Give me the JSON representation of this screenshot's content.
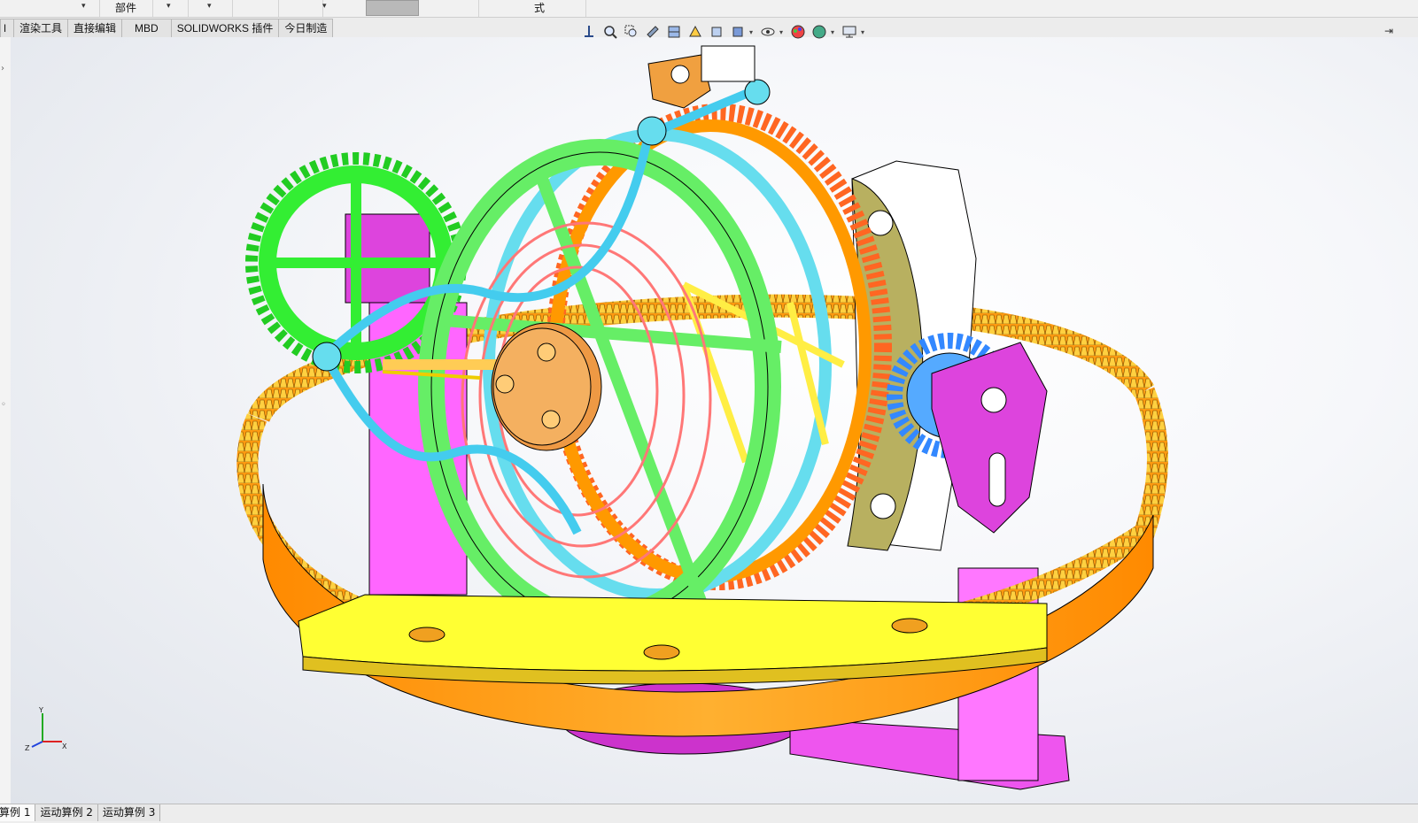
{
  "toolbar_top": {
    "assembly_label": "部件",
    "style_label": "式"
  },
  "tabs": [
    {
      "label": "渲染工具"
    },
    {
      "label": "直接编辑"
    },
    {
      "label": "MBD"
    },
    {
      "label": "SOLIDWORKS 插件"
    },
    {
      "label": "今日制造"
    }
  ],
  "heads_up_toolbar": [
    "view-orientation-icon",
    "zoom-to-fit-icon",
    "zoom-to-area-icon",
    "previous-view-icon",
    "section-view-icon",
    "dynamic-annotation-icon",
    "view-orientation-cube-icon",
    "display-style-icon",
    "hide-show-items-icon",
    "edit-appearance-icon",
    "apply-scene-icon",
    "view-settings-icon"
  ],
  "bottom_tabs": [
    {
      "label": "算例 1"
    },
    {
      "label": "运动算例 2"
    },
    {
      "label": "运动算例 3"
    }
  ],
  "triad": {
    "x": "X",
    "y": "Y",
    "z": "Z"
  },
  "colors": {
    "ring_gear": "#ff8c00",
    "frame_green": "#66ee66",
    "cage_cyan": "#66ddee",
    "support_magenta": "#ee44ee",
    "bridge_yellow": "#ffff33",
    "plate_olive": "#b8b060",
    "hub_gold": "#f0b050",
    "spring_red": "#ff7777",
    "pinion_blue": "#3388ff"
  }
}
